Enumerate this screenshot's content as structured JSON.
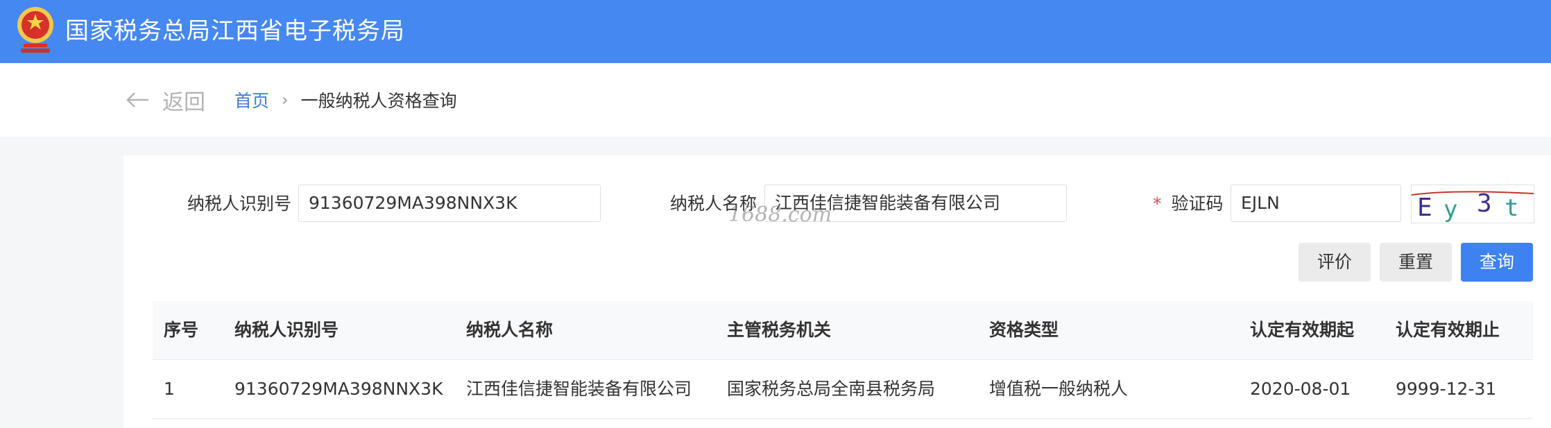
{
  "header": {
    "title": "国家税务总局江西省电子税务局",
    "colors": {
      "bar": "#4688f1"
    }
  },
  "nav": {
    "back_label": "返回",
    "breadcrumb": {
      "home": "首页",
      "current": "一般纳税人资格查询"
    }
  },
  "form": {
    "taxpayer_id": {
      "label": "纳税人识别号",
      "value": "91360729MA398NNX3K"
    },
    "taxpayer_name": {
      "label": "纳税人名称",
      "value": "江西佳信捷智能装备有限公司"
    },
    "captcha": {
      "label": "验证码",
      "required_mark": "*",
      "value": "EJLN",
      "image_text": "Ey3t"
    },
    "watermark": "1688.com"
  },
  "buttons": {
    "evaluate": "评价",
    "reset": "重置",
    "query": "查询"
  },
  "table": {
    "columns": [
      "序号",
      "纳税人识别号",
      "纳税人名称",
      "主管税务机关",
      "资格类型",
      "认定有效期起",
      "认定有效期止"
    ],
    "rows": [
      [
        "1",
        "91360729MA398NNX3K",
        "江西佳信捷智能装备有限公司",
        "国家税务总局全南县税务局",
        "增值税一般纳税人",
        "2020-08-01",
        "9999-12-31"
      ]
    ]
  }
}
